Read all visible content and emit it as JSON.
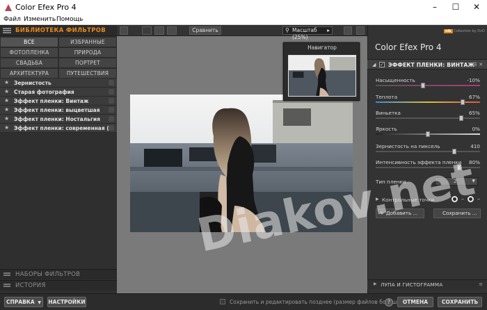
{
  "window": {
    "title": "Color Efex Pro 4",
    "controls": {
      "minimize": "–",
      "maximize": "☐",
      "close": "✕"
    }
  },
  "menu": [
    "Файл",
    "Изменить",
    "Помощь"
  ],
  "library": {
    "title": "БИБЛИОТЕКА ФИЛЬТРОВ",
    "categories": [
      "ВСЕ",
      "ИЗБРАННЫЕ",
      "ФОТОПЛЕНКА",
      "ПРИРОДА",
      "СВАДЬБА",
      "ПОРТРЕТ",
      "АРХИТЕКТУРА",
      "ПУТЕШЕСТВИЯ"
    ],
    "filters": [
      "Зернистость",
      "Старая фотография",
      "Эффект пленки: Винтаж",
      "Эффект пленки: выцветшая",
      "Эффект пленки: Ностальгия",
      "Эффект пленки: современная (бре"
    ],
    "sections": [
      "НАБОРЫ ФИЛЬТРОВ",
      "ИСТОРИЯ"
    ]
  },
  "toolbar": {
    "compare": "Сравнить",
    "zoom": "Масштаб (25%)"
  },
  "navigator": {
    "title": "Навигатор"
  },
  "right": {
    "brand_logo": "nik",
    "brand_text": "Collection by DxO",
    "app_title": "Color Efex Pro",
    "app_version": "4",
    "effect_title": "ЭФФЕКТ ПЛЕНКИ: ВИНТАЖ",
    "params": [
      {
        "label": "Насыщенность",
        "value": "-10%",
        "fraction": 0.45
      },
      {
        "label": "Теплота",
        "value": "67%",
        "fraction": 0.83
      },
      {
        "label": "Виньетка",
        "value": "65%",
        "fraction": 0.82
      },
      {
        "label": "Яркость",
        "value": "0%",
        "fraction": 0.5
      },
      {
        "label": "Зернистость на пиксель",
        "value": "410",
        "fraction": 0.75
      },
      {
        "label": "Интенсивность эффекта пленки",
        "value": "80%",
        "fraction": 0.8
      }
    ],
    "film_type_label": "Тип пленки",
    "film_type_value": "2",
    "control_points": "Контрольные точки",
    "add_button": "Добавить ...",
    "save_button": "Сохранить ...",
    "loupe": "ЛУПА И ГИСТОГРАММА"
  },
  "bottom": {
    "help": "СПРАВКА",
    "settings": "НАСТРОЙКИ",
    "save_later": "Сохранить и редактировать позднее (размер файлов больше)",
    "help_mark": "?",
    "cancel": "ОТМЕНА",
    "save": "СОХРАНИТЬ"
  },
  "watermark": "Diakov.net",
  "colors": {
    "accent": "#e88a1a"
  }
}
